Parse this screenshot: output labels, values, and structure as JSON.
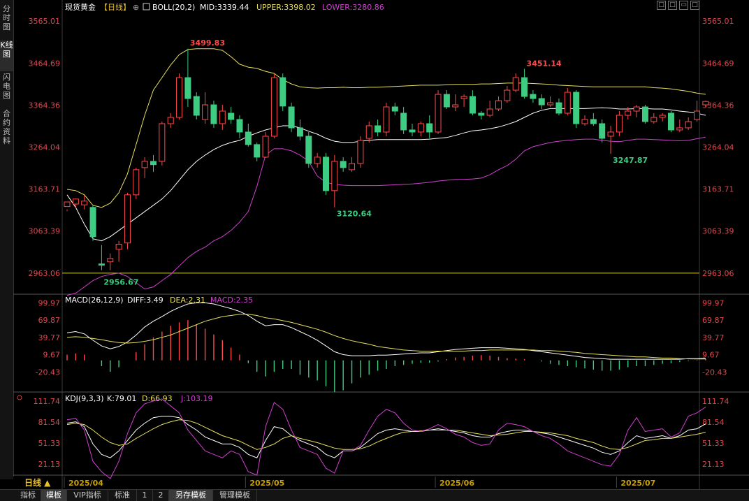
{
  "left_tabs": [
    {
      "label": "分时图"
    },
    {
      "label": "K线图"
    },
    {
      "label": "闪电图"
    },
    {
      "label": "合约资料"
    }
  ],
  "title": {
    "name": "现货黄金",
    "period": "【日线】",
    "indicator": "BOLL(20,2)",
    "mid": "MID:3339.44",
    "upper": "UPPER:3398.02",
    "lower": "LOWER:3280.86"
  },
  "window_controls": [
    "□",
    "□",
    "▭",
    "□"
  ],
  "macd_legend": {
    "name": "MACD(26,12,9)",
    "diff": "DIFF:3.49",
    "dea": "DEA:2.31",
    "macd": "MACD:2.35"
  },
  "kdj_legend": {
    "name": "KDJ(9,3,3)",
    "k": "K:79.01",
    "d": "D:66.93",
    "j": "J:103.19"
  },
  "period_button": "日线 ▲",
  "bottom_tabs": [
    {
      "label": "指标",
      "active": false
    },
    {
      "label": "模板",
      "active": true
    },
    {
      "label": "VIP指标",
      "active": false
    },
    {
      "label": "标准",
      "active": false
    },
    {
      "label": "1",
      "active": false
    },
    {
      "label": "2",
      "active": false
    },
    {
      "label": "另存模板",
      "active": true
    },
    {
      "label": "管理模板",
      "active": false
    }
  ],
  "colors": {
    "up": "#ff4a4a",
    "down": "#3dcc82",
    "boll_upper": "#e8e060",
    "boll_mid": "#ffffff",
    "boll_lower": "#d040d0",
    "macd_dea": "#e8e060",
    "kdj_j": "#d040d0",
    "axis_text": "#e0464b",
    "date_text": "#c8a000",
    "level_line": "#d8d040"
  },
  "chart_data": [
    {
      "type": "candlestick",
      "name": "price",
      "ylim": [
        2912.7,
        3615.4
      ],
      "ticks": [
        3565.01,
        3464.69,
        3364.36,
        3264.04,
        3163.71,
        3063.39,
        2963.06
      ],
      "tick_labels": [
        "3565.01",
        "3464.69",
        "3364.36",
        "3264.04",
        "3163.71",
        "3063.39",
        "2963.06"
      ],
      "hline": 2963.06,
      "hline_label": "2963.06",
      "x_labels": [
        {
          "label": "2025/04",
          "index": 0
        },
        {
          "label": "2025/05",
          "index": 21
        },
        {
          "label": "2025/06",
          "index": 43
        },
        {
          "label": "2025/07",
          "index": 64
        }
      ],
      "annotations": [
        {
          "label": "3499.83",
          "index": 14,
          "value": 3499.83,
          "type": "high"
        },
        {
          "label": "3451.14",
          "index": 53,
          "value": 3451.14,
          "type": "high"
        },
        {
          "label": "3120.64",
          "index": 31,
          "value": 3120.64,
          "type": "low"
        },
        {
          "label": "2956.67",
          "index": 4,
          "value": 2956.67,
          "type": "low"
        },
        {
          "label": "3247.87",
          "index": 63,
          "value": 3247.87,
          "type": "low"
        }
      ],
      "ohlc": [
        [
          3122,
          3133,
          3115,
          3111
        ],
        [
          3128,
          3140,
          3141,
          3118
        ],
        [
          3126,
          3135,
          3149,
          3115
        ],
        [
          3120,
          3050,
          3125,
          3040
        ],
        [
          2985,
          2982,
          3030,
          2970
        ],
        [
          2990,
          2998,
          3010,
          2970
        ],
        [
          3020,
          3032,
          3040,
          2990
        ],
        [
          3035,
          3150,
          3155,
          3020
        ],
        [
          3150,
          3210,
          3215,
          3140
        ],
        [
          3215,
          3230,
          3240,
          3190
        ],
        [
          3230,
          3222,
          3245,
          3205
        ],
        [
          3230,
          3320,
          3325,
          3220
        ],
        [
          3320,
          3335,
          3345,
          3310
        ],
        [
          3335,
          3430,
          3440,
          3330
        ],
        [
          3430,
          3380,
          3499,
          3360
        ],
        [
          3385,
          3340,
          3395,
          3330
        ],
        [
          3330,
          3365,
          3395,
          3320
        ],
        [
          3365,
          3320,
          3375,
          3310
        ],
        [
          3320,
          3350,
          3365,
          3305
        ],
        [
          3345,
          3330,
          3360,
          3320
        ],
        [
          3330,
          3300,
          3340,
          3285
        ],
        [
          3300,
          3270,
          3320,
          3265
        ],
        [
          3270,
          3240,
          3275,
          3230
        ],
        [
          3240,
          3290,
          3300,
          3238
        ],
        [
          3290,
          3430,
          3440,
          3285
        ],
        [
          3430,
          3362,
          3440,
          3350
        ],
        [
          3360,
          3310,
          3370,
          3300
        ],
        [
          3310,
          3290,
          3330,
          3280
        ],
        [
          3290,
          3225,
          3300,
          3215
        ],
        [
          3225,
          3240,
          3250,
          3215
        ],
        [
          3240,
          3160,
          3250,
          3150
        ],
        [
          3160,
          3230,
          3245,
          3120
        ],
        [
          3230,
          3215,
          3240,
          3205
        ],
        [
          3210,
          3225,
          3240,
          3205
        ],
        [
          3225,
          3280,
          3290,
          3215
        ],
        [
          3285,
          3315,
          3325,
          3275
        ],
        [
          3315,
          3300,
          3330,
          3290
        ],
        [
          3300,
          3360,
          3370,
          3290
        ],
        [
          3360,
          3350,
          3370,
          3340
        ],
        [
          3345,
          3305,
          3360,
          3295
        ],
        [
          3305,
          3300,
          3320,
          3290
        ],
        [
          3300,
          3320,
          3325,
          3290
        ],
        [
          3320,
          3300,
          3340,
          3285
        ],
        [
          3300,
          3390,
          3400,
          3295
        ],
        [
          3390,
          3360,
          3400,
          3355
        ],
        [
          3360,
          3365,
          3390,
          3350
        ],
        [
          3380,
          3385,
          3390,
          3360
        ],
        [
          3385,
          3345,
          3400,
          3340
        ],
        [
          3345,
          3340,
          3350,
          3330
        ],
        [
          3340,
          3355,
          3375,
          3335
        ],
        [
          3355,
          3375,
          3385,
          3350
        ],
        [
          3375,
          3400,
          3410,
          3370
        ],
        [
          3400,
          3430,
          3440,
          3395
        ],
        [
          3430,
          3385,
          3451,
          3380
        ],
        [
          3390,
          3380,
          3400,
          3370
        ],
        [
          3380,
          3365,
          3390,
          3355
        ],
        [
          3365,
          3370,
          3385,
          3360
        ],
        [
          3370,
          3345,
          3380,
          3340
        ],
        [
          3345,
          3395,
          3405,
          3340
        ],
        [
          3395,
          3320,
          3400,
          3310
        ],
        [
          3320,
          3330,
          3340,
          3315
        ],
        [
          3330,
          3320,
          3345,
          3315
        ],
        [
          3320,
          3285,
          3330,
          3275
        ],
        [
          3290,
          3300,
          3315,
          3248
        ],
        [
          3300,
          3340,
          3350,
          3290
        ],
        [
          3340,
          3350,
          3360,
          3330
        ],
        [
          3350,
          3360,
          3365,
          3335
        ],
        [
          3360,
          3325,
          3365,
          3320
        ],
        [
          3325,
          3335,
          3345,
          3320
        ],
        [
          3335,
          3340,
          3345,
          3325
        ],
        [
          3345,
          3305,
          3350,
          3300
        ],
        [
          3305,
          3310,
          3330,
          3300
        ],
        [
          3310,
          3325,
          3335,
          3305
        ],
        [
          3330,
          3350,
          3375,
          3325
        ],
        [
          3365,
          3373,
          3375,
          3360
        ]
      ],
      "boll_upper": [
        3163,
        3160,
        3150,
        3125,
        3120,
        3130,
        3155,
        3200,
        3270,
        3340,
        3400,
        3430,
        3460,
        3485,
        3497,
        3499,
        3499,
        3499,
        3495,
        3480,
        3462,
        3455,
        3452,
        3445,
        3440,
        3425,
        3415,
        3408,
        3406,
        3405,
        3406,
        3406,
        3407,
        3406,
        3406,
        3407,
        3407,
        3408,
        3409,
        3410,
        3411,
        3412,
        3412,
        3412,
        3413,
        3414,
        3414,
        3414,
        3415,
        3415,
        3416,
        3417,
        3417,
        3417,
        3416,
        3415,
        3414,
        3412,
        3411,
        3410,
        3409,
        3408,
        3408,
        3408,
        3408,
        3408,
        3408,
        3408,
        3406,
        3405,
        3403,
        3400,
        3397,
        3393,
        3390
      ],
      "boll_mid": [
        3150,
        3120,
        3080,
        3045,
        3040,
        3050,
        3065,
        3080,
        3095,
        3110,
        3125,
        3140,
        3160,
        3185,
        3210,
        3230,
        3245,
        3258,
        3268,
        3275,
        3280,
        3290,
        3298,
        3305,
        3310,
        3315,
        3315,
        3310,
        3302,
        3295,
        3285,
        3278,
        3275,
        3275,
        3278,
        3280,
        3282,
        3282,
        3282,
        3282,
        3282,
        3282,
        3283,
        3285,
        3287,
        3292,
        3298,
        3303,
        3305,
        3308,
        3312,
        3318,
        3325,
        3335,
        3345,
        3352,
        3356,
        3356,
        3356,
        3356,
        3356,
        3357,
        3358,
        3357,
        3355,
        3355,
        3356,
        3356,
        3355,
        3355,
        3353,
        3350,
        3348,
        3345,
        3340
      ],
      "boll_lower": [
        2910,
        2915,
        2930,
        2945,
        2955,
        2960,
        2963,
        2955,
        2940,
        2925,
        2930,
        2945,
        2960,
        2980,
        3000,
        3015,
        3025,
        3040,
        3050,
        3065,
        3085,
        3110,
        3170,
        3245,
        3260,
        3260,
        3255,
        3245,
        3230,
        3195,
        3180,
        3175,
        3173,
        3172,
        3172,
        3172,
        3172,
        3173,
        3174,
        3175,
        3176,
        3178,
        3180,
        3183,
        3185,
        3187,
        3187,
        3188,
        3190,
        3198,
        3210,
        3220,
        3235,
        3255,
        3265,
        3270,
        3275,
        3278,
        3280,
        3282,
        3283,
        3283,
        3280,
        3278,
        3277,
        3280,
        3283,
        3283,
        3282,
        3281,
        3280,
        3279,
        3280,
        3284,
        3288
      ]
    },
    {
      "type": "macd",
      "name": "MACD(26,12,9)",
      "ylim": [
        -55,
        115
      ],
      "ticks": [
        99.97,
        69.87,
        39.77,
        9.67,
        -20.43
      ],
      "tick_labels": [
        "99.97",
        "69.87",
        "39.77",
        "9.67",
        "-20.43"
      ],
      "diff": [
        48,
        50,
        46,
        35,
        25,
        20,
        24,
        32,
        44,
        58,
        68,
        76,
        85,
        92,
        98,
        100,
        100,
        98,
        94,
        90,
        85,
        78,
        68,
        60,
        62,
        62,
        57,
        50,
        43,
        35,
        25,
        15,
        10,
        8,
        8,
        8,
        9,
        9,
        10,
        11,
        12,
        13,
        13,
        15,
        17,
        19,
        20,
        21,
        22,
        22,
        22,
        21,
        20,
        19,
        17,
        15,
        13,
        11,
        9,
        7,
        5,
        4,
        3,
        2,
        2,
        2,
        2,
        2,
        2,
        2,
        2,
        2,
        3,
        3,
        3.49
      ],
      "dea": [
        40,
        41,
        40,
        38,
        36,
        33,
        31,
        30,
        31,
        33,
        36,
        40,
        44,
        50,
        56,
        62,
        68,
        72,
        76,
        78,
        80,
        80,
        78,
        74,
        72,
        69,
        66,
        62,
        58,
        54,
        49,
        43,
        38,
        34,
        31,
        28,
        24,
        22,
        20,
        18,
        17,
        16,
        16,
        16,
        16,
        16,
        16,
        17,
        17,
        18,
        18,
        18,
        18,
        18,
        18,
        17,
        17,
        16,
        15,
        14,
        12,
        11,
        10,
        9,
        8,
        7,
        6,
        6,
        5,
        4,
        4,
        3,
        2.5,
        2.3,
        2.31
      ],
      "macd": [
        10,
        12,
        10,
        0,
        -10,
        -20,
        -12,
        0,
        14,
        28,
        40,
        50,
        60,
        66,
        70,
        62,
        55,
        45,
        35,
        22,
        10,
        -5,
        -20,
        -28,
        -20,
        -15,
        -15,
        -25,
        -30,
        -35,
        -45,
        -55,
        -52,
        -40,
        -30,
        -25,
        -18,
        -15,
        -10,
        -8,
        -6,
        -4,
        -4,
        -2,
        2,
        5,
        6,
        8,
        9,
        8,
        6,
        4,
        3,
        2,
        0,
        -2,
        -6,
        -8,
        -10,
        -12,
        -14,
        -16,
        -18,
        -18,
        -16,
        -12,
        -10,
        -10,
        -8,
        -6,
        -5,
        -3,
        -1,
        0.8,
        2.35
      ]
    },
    {
      "type": "kdj",
      "name": "KDJ(9,3,3)",
      "ylim": [
        5,
        125
      ],
      "ticks": [
        111.74,
        81.54,
        51.33,
        21.13
      ],
      "tick_labels": [
        "111.74",
        "81.54",
        "51.33",
        "21.13"
      ],
      "k": [
        80,
        82,
        75,
        50,
        35,
        30,
        40,
        55,
        70,
        80,
        88,
        90,
        90,
        88,
        78,
        70,
        60,
        55,
        50,
        50,
        45,
        35,
        30,
        55,
        75,
        72,
        62,
        55,
        50,
        45,
        35,
        30,
        40,
        40,
        45,
        55,
        65,
        70,
        72,
        70,
        68,
        68,
        70,
        72,
        70,
        68,
        66,
        62,
        60,
        60,
        65,
        68,
        70,
        70,
        68,
        66,
        64,
        60,
        56,
        52,
        48,
        44,
        38,
        35,
        40,
        52,
        62,
        58,
        60,
        62,
        58,
        62,
        70,
        72,
        79.01
      ],
      "d": [
        78,
        80,
        78,
        70,
        60,
        52,
        48,
        50,
        58,
        65,
        72,
        78,
        82,
        85,
        84,
        80,
        74,
        68,
        62,
        58,
        54,
        48,
        42,
        45,
        50,
        58,
        62,
        58,
        55,
        52,
        48,
        44,
        42,
        42,
        43,
        47,
        53,
        58,
        63,
        67,
        68,
        69,
        70,
        70,
        70,
        70,
        68,
        66,
        64,
        62,
        63,
        64,
        66,
        68,
        68,
        67,
        66,
        64,
        62,
        58,
        55,
        52,
        47,
        43,
        42,
        45,
        50,
        55,
        56,
        58,
        58,
        60,
        62,
        64,
        66.93
      ],
      "j": [
        85,
        87,
        70,
        25,
        10,
        0,
        25,
        65,
        95,
        108,
        112,
        115,
        105,
        95,
        70,
        55,
        40,
        35,
        30,
        40,
        35,
        10,
        5,
        75,
        110,
        100,
        70,
        45,
        40,
        35,
        15,
        8,
        40,
        40,
        48,
        70,
        90,
        100,
        95,
        80,
        70,
        68,
        72,
        78,
        72,
        64,
        60,
        52,
        48,
        50,
        70,
        80,
        78,
        75,
        68,
        62,
        58,
        50,
        40,
        35,
        30,
        25,
        20,
        18,
        35,
        70,
        88,
        68,
        70,
        72,
        60,
        66,
        90,
        95,
        103.19
      ]
    }
  ]
}
